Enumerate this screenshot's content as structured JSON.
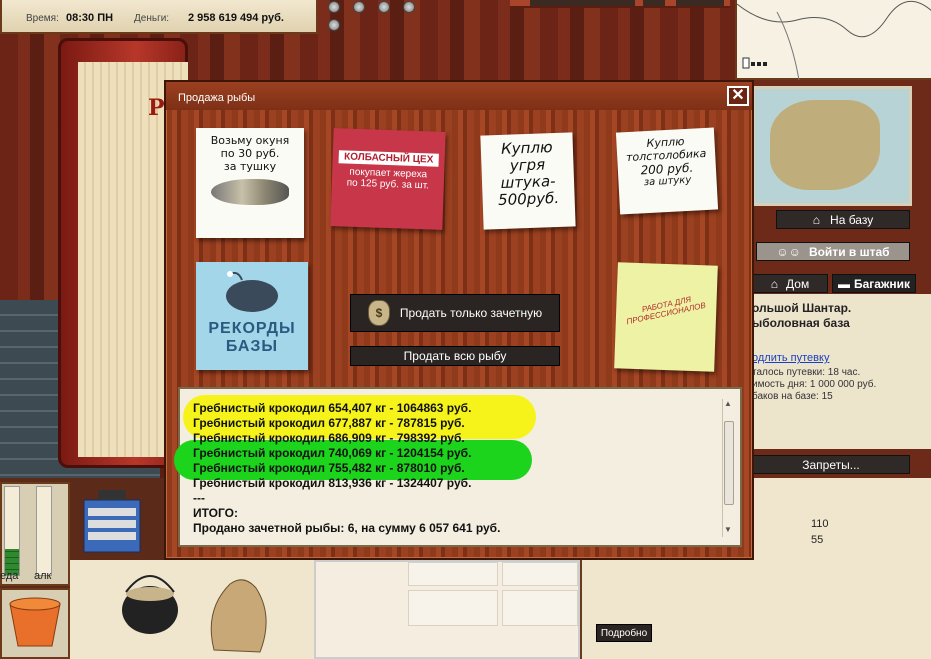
{
  "top_bar": {
    "time_label": "Время:",
    "time_value": "08:30 ПН",
    "money_label": "Деньги:",
    "money_value": "2 958 619 494 руб."
  },
  "book": {
    "title_fragment": "Р"
  },
  "dialog": {
    "title": "Продажа рыбы",
    "close_symbol": "✕",
    "notes": {
      "perch": {
        "line1": "Возьму окуня",
        "line2": "по 30 руб.",
        "line3": "за тушку"
      },
      "sausage": {
        "header": "КОЛБАСНЫЙ ЦЕХ",
        "line1": "покупает жереха",
        "line2": "по 125 руб. за шт."
      },
      "eel": {
        "line1": "Куплю",
        "line2": "угря",
        "line3": "штука-",
        "line4": "500руб."
      },
      "silver_carp": {
        "line1": "Куплю",
        "line2": "толстолобика",
        "line3": "200 руб.",
        "line4": "за штуку"
      },
      "records": {
        "line1": "РЕКОРДЫ",
        "line2": "БАЗЫ"
      },
      "pro_work": {
        "line1": "РАБОТА ДЛЯ",
        "line2": "ПРОФЕССИОНАЛОВ"
      }
    },
    "sell_trophy_label": "Продать только зачетную",
    "sell_all_label": "Продать всю рыбу",
    "money_bag_symbol": "$",
    "log_lines": [
      "Гребнистый крокодил 654,407 кг - 1064863 руб.",
      "Гребнистый крокодил 677,887 кг - 787815 руб.",
      "Гребнистый крокодил 686,909 кг - 798392 руб.",
      "Гребнистый крокодил 740,069 кг - 1204154 руб.",
      "Гребнистый крокодил 755,482 кг - 878010 руб.",
      "Гребнистый крокодил 813,936 кг - 1324407 руб.",
      "---",
      "ИТОГО:",
      "Продано зачетной рыбы: 6, на сумму 6 057 641 руб."
    ]
  },
  "right_panel": {
    "to_base_label": "На базу",
    "enter_hq_label": "Войти в штаб",
    "home_tab": "Дом",
    "trunk_tab": "Багажник",
    "base_name_line1": "ольшой Шантар.",
    "base_name_line2": "ыболовная база",
    "extend_link": "одлить путевку",
    "info_line1": "талось путевки: 18 час.",
    "info_line2": "имость дня: 1 000 000 руб.",
    "info_line3": "баков на базе: 15",
    "bans_label": "Запреты...",
    "stat1": "110",
    "stat2": "55",
    "details_label": "Подробно"
  },
  "inventory": {
    "meter_food_label": "еда",
    "meter_alc_label": "алк",
    "food_level": 0.3,
    "alc_level": 0.0
  },
  "colors": {
    "highlight_yellow": "#f6f31a",
    "highlight_green": "#1cd41c",
    "dialog_wood": "#9b4020"
  }
}
